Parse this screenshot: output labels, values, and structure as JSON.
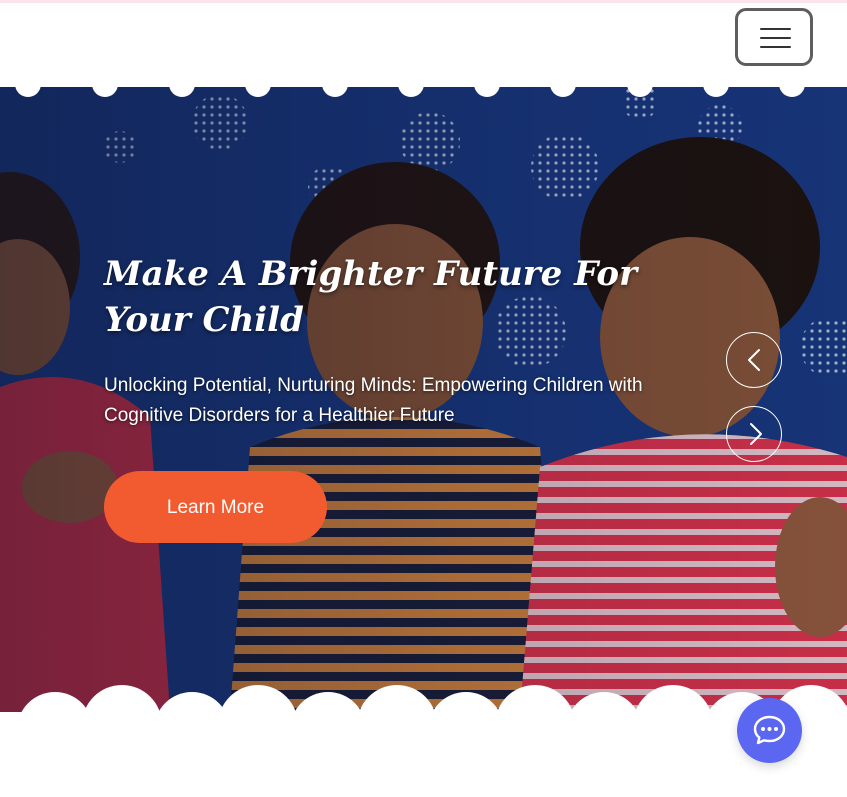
{
  "header": {
    "menu_toggle_icon": "hamburger-menu-icon"
  },
  "hero": {
    "title": "Make A Brighter Future For Your Child",
    "subtitle": "Unlocking Potential, Nurturing Minds: Empowering Children with Cognitive Disorders for a Healthier Future",
    "cta_label": "Learn More",
    "prev_icon": "chevron-left-icon",
    "next_icon": "chevron-right-icon",
    "image_description_icon": "children-photo"
  },
  "chat": {
    "icon": "chat-bubble-icon"
  },
  "colors": {
    "accent": "#f25a30",
    "chat": "#5b67f1",
    "hero_background": "#1c3f8e",
    "top_strip": "#fbe3ea"
  }
}
